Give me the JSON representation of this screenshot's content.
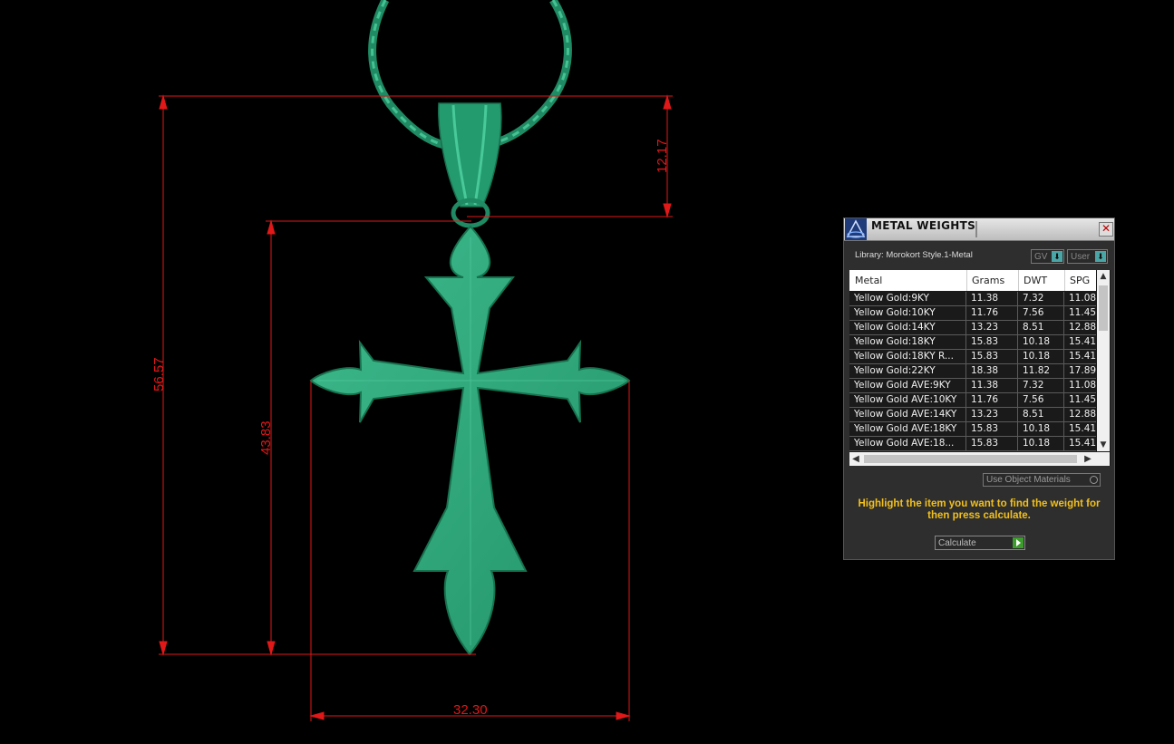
{
  "dimensions": {
    "overall_height": "56.57",
    "body_height": "43.83",
    "bail_height": "12.17",
    "width": "32.30"
  },
  "panel": {
    "title": "METAL WEIGHTS",
    "close_glyph": "✕",
    "library_label": "Library: Morokort Style.1-Metal",
    "gv_label": "GV",
    "user_label": "User",
    "columns": [
      "Metal",
      "Grams",
      "DWT",
      "SPG"
    ],
    "rows": [
      {
        "metal": "Yellow Gold:9KY",
        "grams": "11.38",
        "dwt": "7.32",
        "spg": "11.08"
      },
      {
        "metal": "Yellow Gold:10KY",
        "grams": "11.76",
        "dwt": "7.56",
        "spg": "11.45"
      },
      {
        "metal": "Yellow Gold:14KY",
        "grams": "13.23",
        "dwt": "8.51",
        "spg": "12.88"
      },
      {
        "metal": "Yellow Gold:18KY",
        "grams": "15.83",
        "dwt": "10.18",
        "spg": "15.41"
      },
      {
        "metal": "Yellow Gold:18KY R...",
        "grams": "15.83",
        "dwt": "10.18",
        "spg": "15.41"
      },
      {
        "metal": "Yellow Gold:22KY",
        "grams": "18.38",
        "dwt": "11.82",
        "spg": "17.89"
      },
      {
        "metal": "Yellow Gold AVE:9KY",
        "grams": "11.38",
        "dwt": "7.32",
        "spg": "11.08"
      },
      {
        "metal": "Yellow Gold AVE:10KY",
        "grams": "11.76",
        "dwt": "7.56",
        "spg": "11.45"
      },
      {
        "metal": "Yellow Gold AVE:14KY",
        "grams": "13.23",
        "dwt": "8.51",
        "spg": "12.88"
      },
      {
        "metal": "Yellow Gold AVE:18KY",
        "grams": "15.83",
        "dwt": "10.18",
        "spg": "15.41"
      },
      {
        "metal": "Yellow Gold AVE:18...",
        "grams": "15.83",
        "dwt": "10.18",
        "spg": "15.41"
      }
    ],
    "use_object_materials": "Use Object Materials",
    "hint": "Highlight the item you want to find the weight for then press calculate.",
    "calculate_label": "Calculate"
  },
  "colors": {
    "background": "#000000",
    "dimension_red": "#e01818",
    "model_green": "#2fa57c",
    "hint_yellow": "#f2c01c"
  }
}
